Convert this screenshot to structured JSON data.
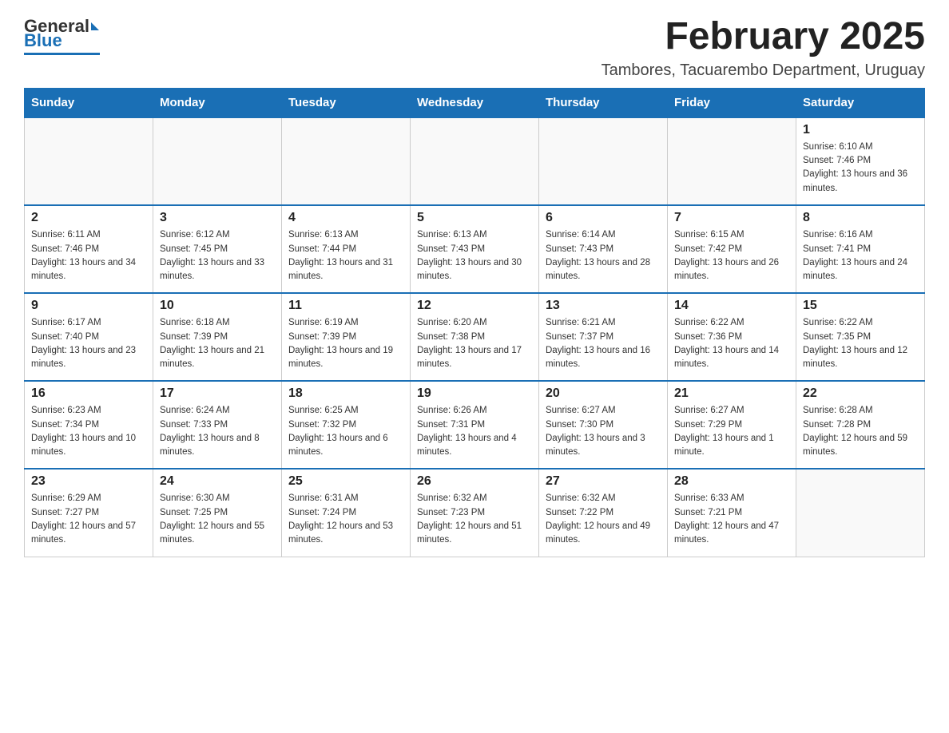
{
  "header": {
    "logo": {
      "general": "General",
      "triangle": "",
      "blue": "Blue"
    },
    "title": "February 2025",
    "location": "Tambores, Tacuarembo Department, Uruguay"
  },
  "days_of_week": [
    "Sunday",
    "Monday",
    "Tuesday",
    "Wednesday",
    "Thursday",
    "Friday",
    "Saturday"
  ],
  "weeks": [
    [
      {
        "day": "",
        "info": ""
      },
      {
        "day": "",
        "info": ""
      },
      {
        "day": "",
        "info": ""
      },
      {
        "day": "",
        "info": ""
      },
      {
        "day": "",
        "info": ""
      },
      {
        "day": "",
        "info": ""
      },
      {
        "day": "1",
        "info": "Sunrise: 6:10 AM\nSunset: 7:46 PM\nDaylight: 13 hours and 36 minutes."
      }
    ],
    [
      {
        "day": "2",
        "info": "Sunrise: 6:11 AM\nSunset: 7:46 PM\nDaylight: 13 hours and 34 minutes."
      },
      {
        "day": "3",
        "info": "Sunrise: 6:12 AM\nSunset: 7:45 PM\nDaylight: 13 hours and 33 minutes."
      },
      {
        "day": "4",
        "info": "Sunrise: 6:13 AM\nSunset: 7:44 PM\nDaylight: 13 hours and 31 minutes."
      },
      {
        "day": "5",
        "info": "Sunrise: 6:13 AM\nSunset: 7:43 PM\nDaylight: 13 hours and 30 minutes."
      },
      {
        "day": "6",
        "info": "Sunrise: 6:14 AM\nSunset: 7:43 PM\nDaylight: 13 hours and 28 minutes."
      },
      {
        "day": "7",
        "info": "Sunrise: 6:15 AM\nSunset: 7:42 PM\nDaylight: 13 hours and 26 minutes."
      },
      {
        "day": "8",
        "info": "Sunrise: 6:16 AM\nSunset: 7:41 PM\nDaylight: 13 hours and 24 minutes."
      }
    ],
    [
      {
        "day": "9",
        "info": "Sunrise: 6:17 AM\nSunset: 7:40 PM\nDaylight: 13 hours and 23 minutes."
      },
      {
        "day": "10",
        "info": "Sunrise: 6:18 AM\nSunset: 7:39 PM\nDaylight: 13 hours and 21 minutes."
      },
      {
        "day": "11",
        "info": "Sunrise: 6:19 AM\nSunset: 7:39 PM\nDaylight: 13 hours and 19 minutes."
      },
      {
        "day": "12",
        "info": "Sunrise: 6:20 AM\nSunset: 7:38 PM\nDaylight: 13 hours and 17 minutes."
      },
      {
        "day": "13",
        "info": "Sunrise: 6:21 AM\nSunset: 7:37 PM\nDaylight: 13 hours and 16 minutes."
      },
      {
        "day": "14",
        "info": "Sunrise: 6:22 AM\nSunset: 7:36 PM\nDaylight: 13 hours and 14 minutes."
      },
      {
        "day": "15",
        "info": "Sunrise: 6:22 AM\nSunset: 7:35 PM\nDaylight: 13 hours and 12 minutes."
      }
    ],
    [
      {
        "day": "16",
        "info": "Sunrise: 6:23 AM\nSunset: 7:34 PM\nDaylight: 13 hours and 10 minutes."
      },
      {
        "day": "17",
        "info": "Sunrise: 6:24 AM\nSunset: 7:33 PM\nDaylight: 13 hours and 8 minutes."
      },
      {
        "day": "18",
        "info": "Sunrise: 6:25 AM\nSunset: 7:32 PM\nDaylight: 13 hours and 6 minutes."
      },
      {
        "day": "19",
        "info": "Sunrise: 6:26 AM\nSunset: 7:31 PM\nDaylight: 13 hours and 4 minutes."
      },
      {
        "day": "20",
        "info": "Sunrise: 6:27 AM\nSunset: 7:30 PM\nDaylight: 13 hours and 3 minutes."
      },
      {
        "day": "21",
        "info": "Sunrise: 6:27 AM\nSunset: 7:29 PM\nDaylight: 13 hours and 1 minute."
      },
      {
        "day": "22",
        "info": "Sunrise: 6:28 AM\nSunset: 7:28 PM\nDaylight: 12 hours and 59 minutes."
      }
    ],
    [
      {
        "day": "23",
        "info": "Sunrise: 6:29 AM\nSunset: 7:27 PM\nDaylight: 12 hours and 57 minutes."
      },
      {
        "day": "24",
        "info": "Sunrise: 6:30 AM\nSunset: 7:25 PM\nDaylight: 12 hours and 55 minutes."
      },
      {
        "day": "25",
        "info": "Sunrise: 6:31 AM\nSunset: 7:24 PM\nDaylight: 12 hours and 53 minutes."
      },
      {
        "day": "26",
        "info": "Sunrise: 6:32 AM\nSunset: 7:23 PM\nDaylight: 12 hours and 51 minutes."
      },
      {
        "day": "27",
        "info": "Sunrise: 6:32 AM\nSunset: 7:22 PM\nDaylight: 12 hours and 49 minutes."
      },
      {
        "day": "28",
        "info": "Sunrise: 6:33 AM\nSunset: 7:21 PM\nDaylight: 12 hours and 47 minutes."
      },
      {
        "day": "",
        "info": ""
      }
    ]
  ]
}
